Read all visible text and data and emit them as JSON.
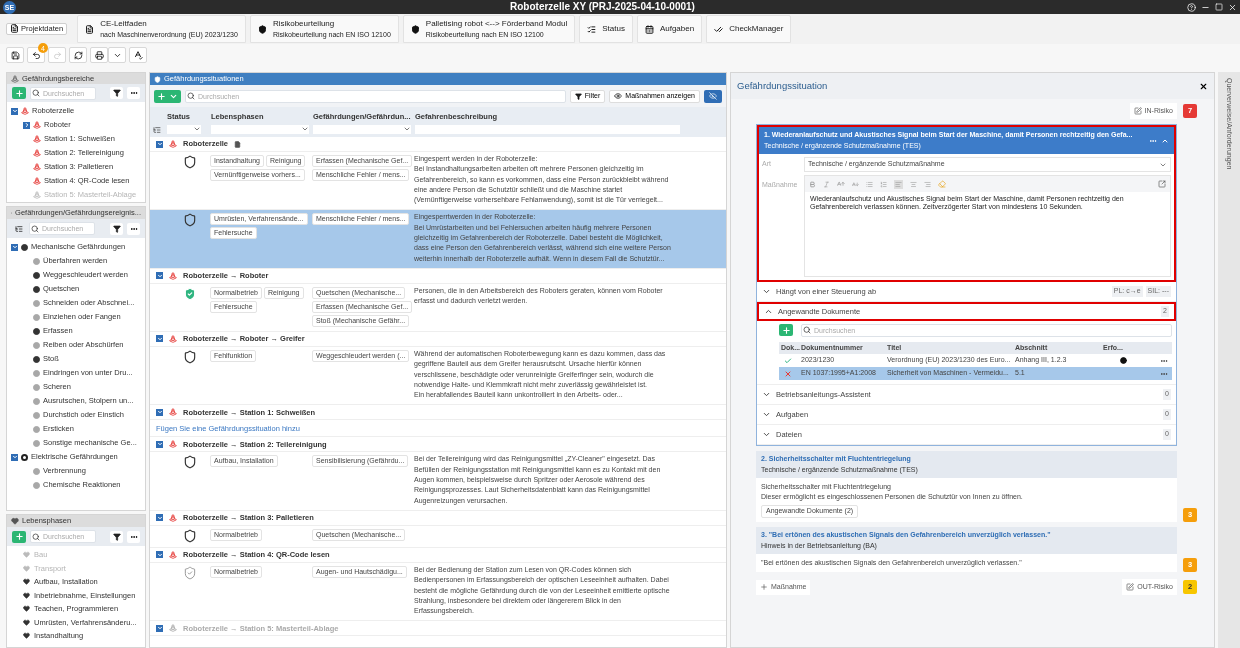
{
  "window": {
    "logo": "SE",
    "title": "Roboterzelle XY (PRJ-2025-04-10-0001)"
  },
  "tabs": [
    {
      "kind": "project",
      "label": "Projektdaten"
    },
    {
      "kind": "document",
      "label": "CE-Leitfaden",
      "sub": "nach Maschinenverordnung (EU) 2023/1230"
    },
    {
      "kind": "shield",
      "label": "Risikobeurteilung",
      "sub": "Risikobeurteilung nach EN ISO 12100"
    },
    {
      "kind": "shield",
      "label": "Palletising robot <--> Förderband Modul",
      "sub": "Risikobeurteilung nach EN ISO 12100"
    },
    {
      "kind": "list",
      "label": "Status"
    },
    {
      "kind": "calendar",
      "label": "Aufgaben"
    },
    {
      "kind": "check",
      "label": "CheckManager"
    }
  ],
  "toolbar": {
    "undo_count": "4",
    "redo_disabled": true
  },
  "hazard_areas": {
    "title": "Gefährdungsbereiche",
    "search_placeholder": "Durchsuchen",
    "tree": [
      {
        "label": "Roboterzelle",
        "disabled": false,
        "expanded": true,
        "children": [
          {
            "label": "Roboter",
            "disabled": false,
            "expanded": false
          },
          {
            "label": "Station 1: Schweißen",
            "disabled": false
          },
          {
            "label": "Station 2: Teilereinigung",
            "disabled": false
          },
          {
            "label": "Station 3: Palletieren",
            "disabled": false
          },
          {
            "label": "Station 4: QR-Code lesen",
            "disabled": false
          },
          {
            "label": "Station 5: Masterteil-Ablage",
            "disabled": true
          }
        ]
      }
    ]
  },
  "hazards": {
    "title": "Gefährdungen/Gefährdungsereignis...",
    "search_placeholder": "Durchsuchen",
    "tree": [
      {
        "label": "Mechanische Gefährdungen",
        "used": true,
        "expanded": true,
        "children": [
          {
            "label": "Überfahren werden",
            "used": false
          },
          {
            "label": "Weggeschleudert werden",
            "used": true
          },
          {
            "label": "Quetschen",
            "used": true
          },
          {
            "label": "Schneiden oder Abschnei...",
            "used": false
          },
          {
            "label": "Einziehen oder Fangen",
            "used": false
          },
          {
            "label": "Erfassen",
            "used": true
          },
          {
            "label": "Reiben oder Abschürfen",
            "used": false
          },
          {
            "label": "Stoß",
            "used": true
          },
          {
            "label": "Eindringen von unter Dru...",
            "used": false
          },
          {
            "label": "Scheren",
            "used": false
          },
          {
            "label": "Ausrutschen, Stolpern un...",
            "used": false
          },
          {
            "label": "Durchstich oder Einstich",
            "used": false
          },
          {
            "label": "Ersticken",
            "used": false
          },
          {
            "label": "Sonstige mechanische Ge...",
            "used": false
          }
        ]
      },
      {
        "label": "Elektrische Gefährdungen",
        "used": false,
        "expanded": true,
        "children": [
          {
            "label": "Verbrennung",
            "used": false
          },
          {
            "label": "Chemische Reaktionen",
            "used": false
          }
        ]
      }
    ]
  },
  "life_phases": {
    "title": "Lebensphasen",
    "search_placeholder": "Durchsuchen",
    "items": [
      {
        "label": "Bau",
        "disabled": true
      },
      {
        "label": "Transport",
        "disabled": true
      },
      {
        "label": "Aufbau, Installation",
        "disabled": false
      },
      {
        "label": "Inbetriebnahme, Einstellungen",
        "disabled": false
      },
      {
        "label": "Teachen, Programmieren",
        "disabled": false
      },
      {
        "label": "Umrüsten, Verfahrensänderu...",
        "disabled": false
      },
      {
        "label": "Instandhaltung",
        "disabled": false
      }
    ]
  },
  "situations": {
    "title": "Gefährdungssituationen",
    "search_placeholder": "Durchsuchen",
    "filter_label": "Filter",
    "measures_label": "Maßnahmen anzeigen",
    "columns": [
      "Status",
      "Lebensphasen",
      "Gefährdungen/Gefährdun...",
      "Gefahrenbeschreibung"
    ],
    "groups": [
      {
        "title": "Roboterzelle",
        "disabled": false,
        "expanded": true,
        "has_document": true,
        "rows": [
          {
            "kind": "open",
            "selected": false,
            "phases": [
              "Instandhaltung",
              "Reinigung",
              "Vernünftigerweise vorhers..."
            ],
            "hazards": [
              "Erfassen (Mechanische Gef...",
              "Menschliche Fehler / mens..."
            ],
            "description": "Eingesperrt werden in der Roboterzelle:\nBei Instandhaltungsarbeiten arbeiten oft mehrere Personen gleichzeitig im\nGefahrenbereich, so kann es vorkommen, dass eine Person zurückbleibt während\neine andere Person die Schutztür schließt und die Maschine startet\n(Vernünftigerweise vorhersehbare Fehlanwendung), somit ist die Tür verriegelt..."
          },
          {
            "kind": "open",
            "selected": true,
            "phases": [
              "Umrüsten, Verfahrensände...",
              "Fehlersuche"
            ],
            "hazards": [
              "Menschliche Fehler / mens..."
            ],
            "description": "Eingesperrtwerden in der Roboterzelle:\nBei Umrüstarbeiten und bei Fehlersuchen arbeiten häufig mehrere Personen\ngleichzeitig im Gefahrenbereich der Roboterzelle. Dabei besteht die Möglichkeit,\ndass eine Person den Gefahrenbereich verlässt, während sich eine weitere Person\nweiterhin innerhalb der Roboterzelle aufhält. Wenn in diesem Fall die Schutztür..."
          }
        ]
      },
      {
        "title": "Roboterzelle → Roboter",
        "disabled": false,
        "expanded": true,
        "rows": [
          {
            "kind": "safe",
            "selected": false,
            "phases": [
              "Normalbetrieb",
              "Reinigung",
              "Fehlersuche"
            ],
            "hazards": [
              "Quetschen (Mechanische...",
              "Erfassen (Mechanische Gef...",
              "Stoß (Mechanische Gefähr..."
            ],
            "description": "Personen, die in den Arbeitsbereich des Roboters geraten, können vom Roboter\nerfasst und dadurch verletzt werden."
          }
        ]
      },
      {
        "title": "Roboterzelle → Roboter → Greifer",
        "disabled": false,
        "expanded": true,
        "rows": [
          {
            "kind": "open",
            "selected": false,
            "phases": [
              "Fehlfunktion"
            ],
            "hazards": [
              "Weggeschleudert werden (..."
            ],
            "description": "Während der automatischen Roboterbewegung kann es dazu kommen, dass das\ngegriffene Bauteil aus dem Greifer herausrutscht. Ursache hierfür können\nverschlissene, beschädigte oder verunreinigte Greiferfinger sein, wodurch die\nnotwendige Halte- und Klemmkraft nicht mehr zuverlässig gewährleistet ist.\nEin herabfallendes Bauteil kann unkontrolliert in den Arbeits- oder..."
          }
        ]
      },
      {
        "title": "Roboterzelle → Station 1: Schweißen",
        "disabled": false,
        "expanded": true,
        "add_link": "Fügen Sie eine Gefährdungssituation hinzu"
      },
      {
        "title": "Roboterzelle → Station 2: Teilereinigung",
        "disabled": false,
        "expanded": true,
        "rows": [
          {
            "kind": "open",
            "selected": false,
            "phases": [
              "Aufbau, Installation"
            ],
            "hazards": [
              "Sensibilisierung (Gefährdu..."
            ],
            "description": "Bei der Teilereinigung wird das Reinigungsmittel „ZY-Cleaner\" eingesetzt. Das\nBefüllen der Reinigungsstation mit Reinigungsmittel kann es zu Kontakt mit den\nAugen kommen, beispielsweise durch Spritzer oder Aerosole während des\nReinigungsprozesses. Laut Sicherheitsdatenblatt kann das Reinigungsmittel\nAugenreizungen verursachen."
          }
        ]
      },
      {
        "title": "Roboterzelle → Station 3: Palletieren",
        "disabled": false,
        "expanded": true,
        "rows": [
          {
            "kind": "open",
            "selected": false,
            "phases": [
              "Normalbetrieb"
            ],
            "hazards": [
              "Quetschen (Mechanische..."
            ]
          }
        ]
      },
      {
        "title": "Roboterzelle → Station 4: QR-Code lesen",
        "disabled": false,
        "expanded": true,
        "rows": [
          {
            "kind": "partial",
            "selected": false,
            "phases": [
              "Normalbetrieb"
            ],
            "hazards": [
              "Augen- und Hautschädigu..."
            ],
            "description": "Bei der Bedienung der Station zum Lesen von QR-Codes können sich\nBedienpersonen im Erfassungsbereich der optischen Leseeinheit aufhalten. Dabei\nbesteht die mögliche Gefährdung durch die von der Leseeinheit emittierte optische\nStrahlung, insbesondere bei direktem oder längererem Blick in den\nErfassungsbereich."
          }
        ]
      },
      {
        "title": "Roboterzelle → Station 5: Masterteil-Ablage",
        "disabled": true,
        "expanded": true
      }
    ]
  },
  "detail": {
    "title": "Gefährdungssituation",
    "in_risk": {
      "label": "IN-Risiko",
      "value": "7",
      "color": "#e53935"
    },
    "measures": [
      {
        "title": "1. Wiederanlaufschutz und Akustisches Signal beim Start der Maschine, damit Personen rechtzeitig den Gefa...",
        "subtitle": "Technische / ergänzende Schutzmaßnahme (TES)",
        "expanded": true,
        "highlighted": true,
        "fields": {
          "art_label": "Art",
          "art_value": "Technische / ergänzende Schutzmaßnahme",
          "text_label": "Maßnahme",
          "text": "Wiederanlaufschutz und Akustisches Signal beim Start der Maschine, damit Personen rechtzeitig den Gefahrenbereich verlassen können. Zeitverzögerter Start von mindestens 10 Sekunden."
        },
        "sections": [
          {
            "label": "Hängt von einer Steuerung ab",
            "expanded": false,
            "highlighted": false,
            "pills": [
              "PL: c→e",
              "SIL: ---"
            ]
          },
          {
            "label": "Angewandte Dokumente",
            "expanded": true,
            "highlighted": true,
            "count": "2",
            "documents": {
              "search_placeholder": "Durchsuchen",
              "columns": [
                "Dok...",
                "Dokumentnummer",
                "Titel",
                "Abschnitt",
                "Erfo..."
              ],
              "rows": [
                {
                  "valid": true,
                  "number": "2023/1230",
                  "title": "Verordnung (EU) 2023/1230 des Euro...",
                  "section": "Anhang III, 1.2.3",
                  "required": true,
                  "selected": false
                },
                {
                  "valid": false,
                  "number": "EN 1037:1995+A1:2008",
                  "title": "Sicherheit von Maschinen - Vermeidu...",
                  "section": "5.1",
                  "required": false,
                  "selected": true
                }
              ]
            }
          },
          {
            "label": "Betriebsanleitungs-Assistent",
            "expanded": false,
            "highlighted": false,
            "count": "0"
          },
          {
            "label": "Aufgaben",
            "expanded": false,
            "highlighted": false,
            "count": "0"
          },
          {
            "label": "Dateien",
            "expanded": false,
            "highlighted": false,
            "count": "0"
          }
        ]
      },
      {
        "title": "2. Sicherheitsschalter mit Fluchtentriegelung",
        "subtitle": "Technische / ergänzende Schutzmaßnahme (TES)",
        "expanded": false,
        "highlighted": false,
        "body": "Sicherheitsschalter mit Fluchtentriegelung\nDieser ermöglicht es eingeschlossenen Personen die Schutztür von Innen zu öffnen.",
        "docs_button": "Angewandte Dokumente (2)",
        "risk": {
          "value": "3",
          "color": "#f59e0b"
        }
      },
      {
        "title": "3. \"Bei ertönen des akustischen Signals den Gefahrenbereich unverzüglich verlassen.\"",
        "subtitle": "Hinweis in der Betriebsanleitung (BA)",
        "expanded": false,
        "highlighted": false,
        "body": "\"Bei ertönen des akustischen Signals den Gefahrenbereich unverzüglich verlassen.\"",
        "risk": {
          "value": "3",
          "color": "#f59e0b"
        }
      }
    ],
    "add_label": "Maßnahme",
    "out_risk": {
      "label": "OUT-Risiko",
      "value": "2",
      "color": "#f7c600"
    }
  },
  "side_tab": "Querverweise/Anforderungen"
}
